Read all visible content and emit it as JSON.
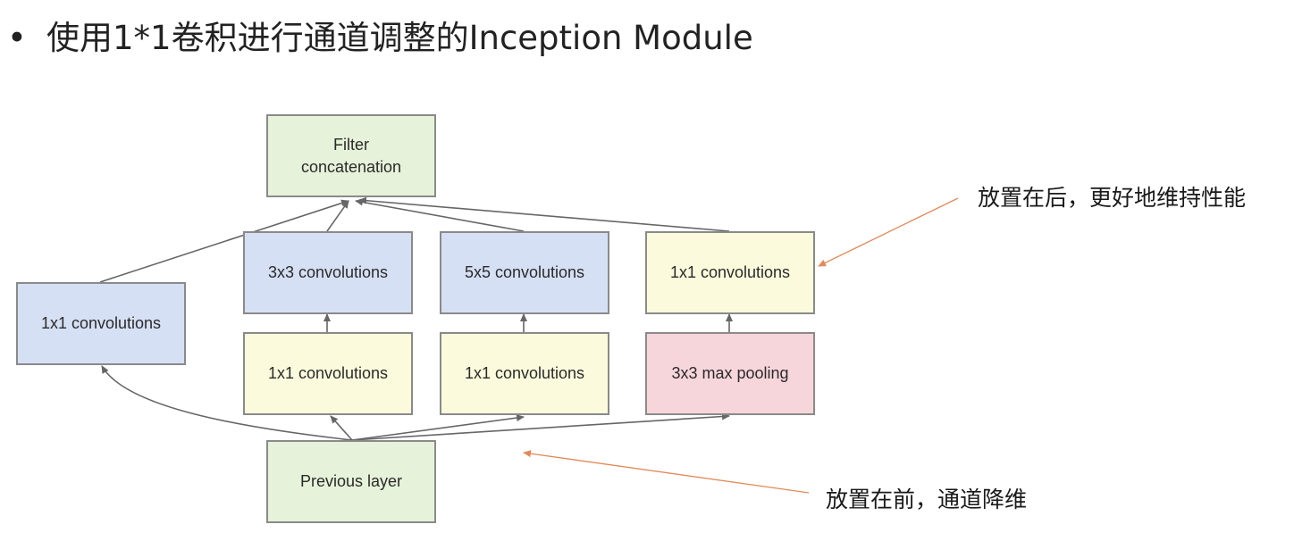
{
  "title": {
    "bullet": "•",
    "text": "使用1*1卷积进行通道调整的Inception Module"
  },
  "diagram": {
    "filter_concat_line1": "Filter",
    "filter_concat_line2": "concatenation",
    "branch1_conv": "1x1 convolutions",
    "branch2_conv3x3": "3x3 convolutions",
    "branch2_reduce": "1x1 convolutions",
    "branch3_conv5x5": "5x5 convolutions",
    "branch3_reduce": "1x1 convolutions",
    "branch4_proj": "1x1 convolutions",
    "branch4_pool": "3x3 max pooling",
    "previous_layer": "Previous layer"
  },
  "annotations": {
    "after": "放置在后，更好地维持性能",
    "before": "放置在前，通道降维"
  },
  "colors": {
    "green": "#e6f2d9",
    "blue": "#d6e0f5",
    "yellow": "#fbfadc",
    "pink": "#f7d6db",
    "edge": "#666666",
    "annotation_arrow": "#e08a5a"
  }
}
